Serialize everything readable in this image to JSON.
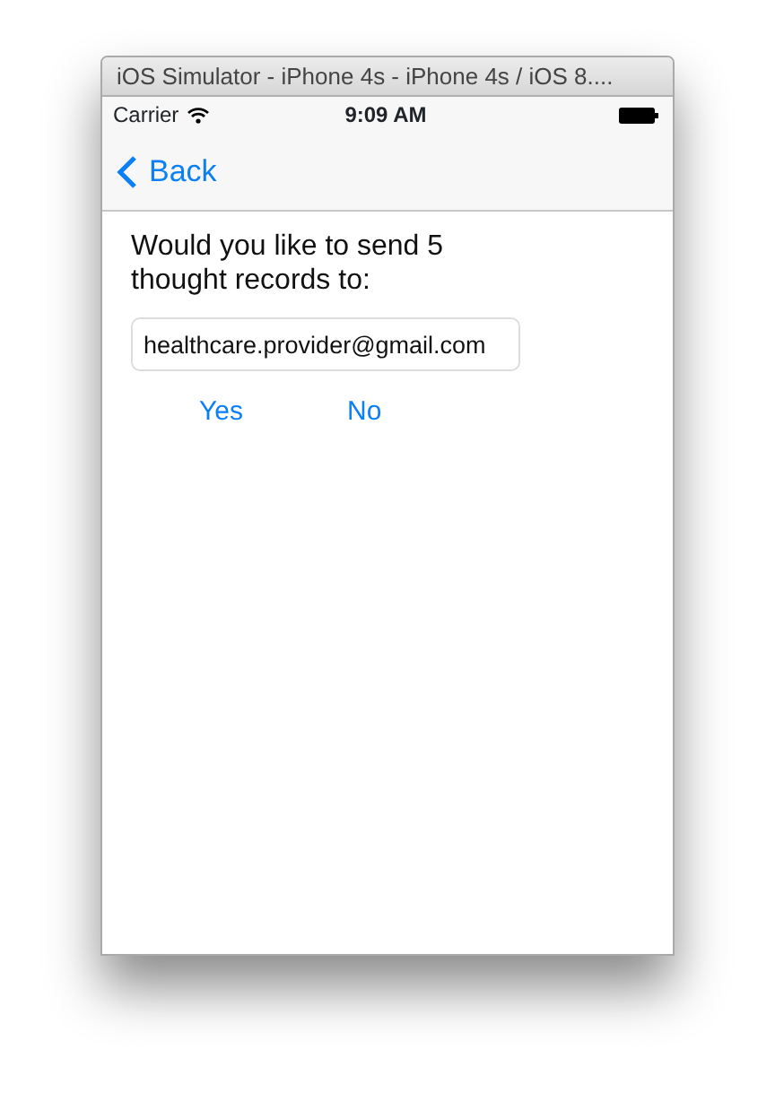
{
  "window": {
    "title": "iOS Simulator - iPhone 4s - iPhone 4s / iOS 8...."
  },
  "status_bar": {
    "carrier": "Carrier",
    "time": "9:09 AM"
  },
  "nav_bar": {
    "back": "Back"
  },
  "message": "Would you like to send 5 thought records to:",
  "email_field": {
    "value": "healthcare.provider@gmail.com"
  },
  "buttons": [
    "Yes",
    "No"
  ]
}
